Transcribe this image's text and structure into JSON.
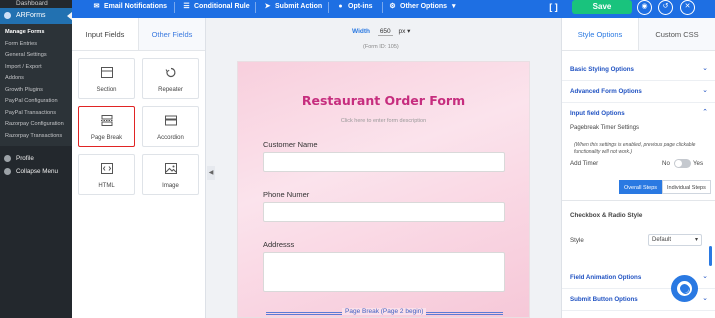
{
  "wp_sidebar": {
    "dashboard": "Dashboard",
    "current": "ARForms",
    "submenu": [
      "Manage Forms",
      "Form Entries",
      "General Settings",
      "Import / Export",
      "Addons",
      "Growth Plugins",
      "PayPal Configuration",
      "PayPal Transactions",
      "Razorpay Configuration",
      "Razorpay Transactions"
    ],
    "profile": "Profile",
    "collapse": "Collapse Menu"
  },
  "toolbar": {
    "email_notifications": "Email Notifications",
    "conditional_rule": "Conditional Rule",
    "submit_action": "Submit Action",
    "opt_ins": "Opt-ins",
    "other_options": "Other Options",
    "save": "Save",
    "accent": "#1e6fe3"
  },
  "field_panel": {
    "tabs": [
      "Input Fields",
      "Other Fields"
    ],
    "tiles": [
      "Section",
      "Repeater",
      "Page Break",
      "Accordion",
      "HTML",
      "Image"
    ]
  },
  "canvas": {
    "width_label": "Width",
    "width_value": "650",
    "width_unit": "px",
    "form_id": "(Form ID: 105)",
    "title": "Restaurant Order Form",
    "description": "Click here to enter form description",
    "fields": [
      "Customer Name",
      "Phone Numer",
      "Addresss"
    ],
    "page_break": "Page Break (Page 2 begin)",
    "title_color": "#c62d7e"
  },
  "right_panel": {
    "tabs": [
      "Style Options",
      "Custom CSS"
    ],
    "sections": [
      "Basic Styling Options",
      "Advanced Form Options",
      "Input field Options"
    ],
    "timer_heading": "Pagebreak Timer Settings",
    "timer_note": "(When this settings is enabled, previous page clickable functionality will not work.)",
    "add_timer": "Add Timer",
    "no": "No",
    "yes": "Yes",
    "overall_steps": "Overall Steps",
    "individual_steps": "Individual Steps",
    "checkbox_heading": "Checkbox & Radio Style",
    "style_label": "Style",
    "style_value": "Default",
    "bottom_sections": [
      "Field Animation Options",
      "Submit Button Options"
    ]
  }
}
